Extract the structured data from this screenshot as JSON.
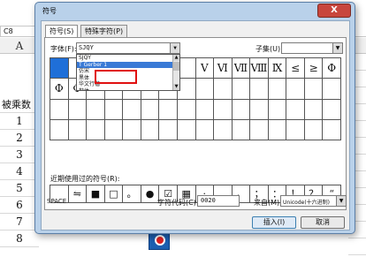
{
  "spreadsheet": {
    "name_box": "C8",
    "column_a": "A",
    "header_cell": "被乘数",
    "row_values": [
      "1",
      "2",
      "3",
      "4",
      "5",
      "6",
      "7",
      "8"
    ]
  },
  "dialog": {
    "title": "符号",
    "close_label": "X",
    "tabs": [
      {
        "label": "符号(S)",
        "active": true
      },
      {
        "label": "特殊字符(P)",
        "active": false
      }
    ],
    "font_label": "字体(F):",
    "font_value": "SJQY",
    "subset_label": "子集(U):",
    "font_dropdown_options": [
      {
        "label": "SJQY",
        "highlighted": false
      },
      {
        "label": "T Gerber 1",
        "highlighted": true
      },
      {
        "label": "仿宋",
        "highlighted": false
      },
      {
        "label": "黑体",
        "highlighted": false
      },
      {
        "label": "华文行楷",
        "highlighted": false
      },
      {
        "label": "楷体",
        "highlighted": false
      },
      {
        "label": "宋体",
        "highlighted": false
      }
    ],
    "grid_rows": [
      [
        "",
        "",
        "",
        "",
        "",
        "",
        "",
        "",
        "",
        "",
        "Ⅴ",
        "Ⅵ",
        "Ⅶ",
        "Ⅷ",
        "Ⅸ",
        "≤",
        "≥",
        "Φ"
      ],
      [
        "Φ",
        "Φ",
        "",
        "",
        "",
        "",
        "",
        "",
        "",
        "",
        "",
        "",
        "",
        "",
        "",
        ""
      ],
      [
        "",
        "",
        "",
        "",
        "",
        "",
        "",
        "",
        "",
        "",
        "",
        "",
        "",
        "",
        "",
        ""
      ],
      [
        "",
        "",
        "",
        "",
        "",
        "",
        "",
        "",
        "",
        "",
        "",
        "",
        "",
        "",
        "",
        ""
      ]
    ],
    "recent_label": "近期使用过的符号(R):",
    "recent_symbols": [
      "",
      "⇋",
      "■",
      "□",
      "。",
      "●",
      "☑",
      "▦",
      "·",
      "、",
      "，",
      "；",
      "：",
      "！",
      "？",
      "“"
    ],
    "char_name": "SPACE",
    "code_label": "字符代码(C):",
    "code_value": "0020",
    "from_label": "来自(M):",
    "from_value": "Unicode(十六进制)",
    "insert_label": "插入(I)",
    "cancel_label": "取消"
  }
}
